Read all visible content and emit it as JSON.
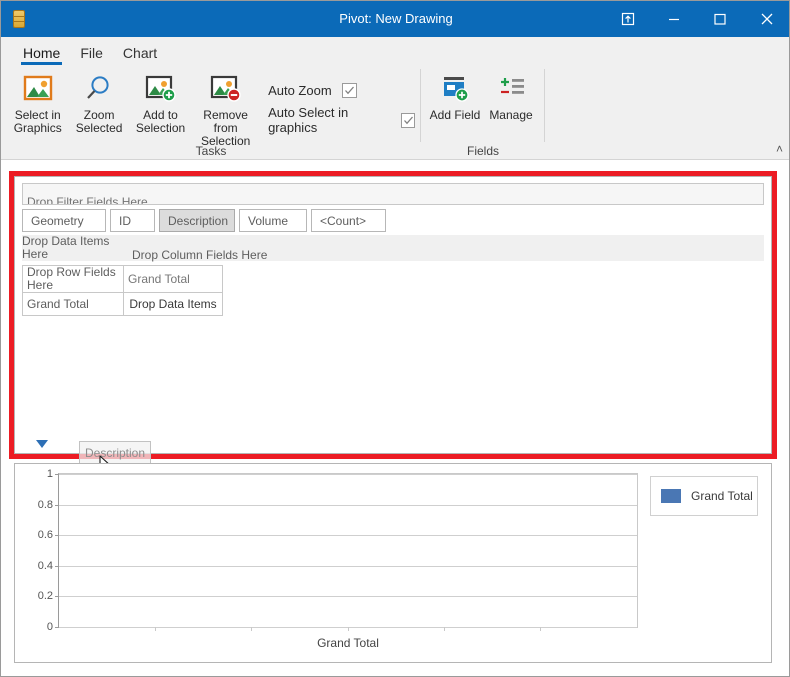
{
  "window": {
    "title": "Pivot: New Drawing",
    "app_icon": "database-icon",
    "titlebar_color": "#0b6ab8",
    "buttons": {
      "dock": "dock-icon",
      "minimize": "minimize-icon",
      "maximize": "maximize-icon",
      "close": "close-icon"
    }
  },
  "ribbon": {
    "tabs": [
      {
        "label": "Home",
        "active": true
      },
      {
        "label": "File",
        "active": false
      },
      {
        "label": "Chart",
        "active": false
      }
    ],
    "groups": [
      {
        "name": "Tasks",
        "label": "Tasks",
        "buttons": [
          {
            "label": "Select in Graphics",
            "icon": "picture-icon"
          },
          {
            "label": "Zoom Selected",
            "icon": "magnifier-icon"
          },
          {
            "label": "Add to Selection",
            "icon": "picture-add-icon"
          },
          {
            "label": "Remove from Selection",
            "icon": "picture-remove-icon"
          }
        ],
        "toggles": [
          {
            "label": "Auto Zoom",
            "checked": true
          },
          {
            "label": "Auto Select in graphics",
            "checked": true
          }
        ]
      },
      {
        "name": "Fields",
        "label": "Fields",
        "buttons": [
          {
            "label": "Add Field",
            "icon": "field-add-icon"
          },
          {
            "label": "Manage",
            "icon": "manage-list-icon"
          }
        ]
      }
    ],
    "collapse_arrow": "˄"
  },
  "highlight": {
    "color": "#ec1c24"
  },
  "pivot": {
    "filter_zone_text": "Drop Filter Fields Here",
    "field_buttons": [
      {
        "label": "Geometry",
        "pressed": false,
        "has_caret": false
      },
      {
        "label": "ID",
        "pressed": false,
        "has_caret": false
      },
      {
        "label": "Description",
        "pressed": true,
        "has_caret": true
      },
      {
        "label": "Volume",
        "pressed": false,
        "has_caret": false
      },
      {
        "label": "<Count>",
        "pressed": false,
        "has_caret": false
      }
    ],
    "drop_data_items_top": "Drop Data Items Here",
    "drop_column_fields": "Drop Column Fields Here",
    "drop_row_fields": "Drop Row Fields Here",
    "grand_total_column": "Grand Total",
    "grand_total_row": "Grand Total",
    "drop_data_items_cell": "Drop Data Items",
    "drag_ghost_label": "Description"
  },
  "chart_data": {
    "type": "bar",
    "title": "",
    "categories": [
      "Grand Total"
    ],
    "series": [
      {
        "name": "Grand Total",
        "values": [
          0
        ],
        "color": "#4a77b4"
      }
    ],
    "values": [
      0
    ],
    "xlabel": "Grand Total",
    "ylabel": "",
    "ylim": [
      0,
      1
    ],
    "yticks": [
      "0",
      "0.2",
      "0.4",
      "0.6",
      "0.8",
      "1"
    ],
    "ytick_values": [
      0,
      0.2,
      0.4,
      0.6,
      0.8,
      1
    ],
    "grid": true,
    "legend_position": "right",
    "legend_entries": [
      {
        "label": "Grand Total",
        "color": "#4a77b4"
      }
    ]
  }
}
